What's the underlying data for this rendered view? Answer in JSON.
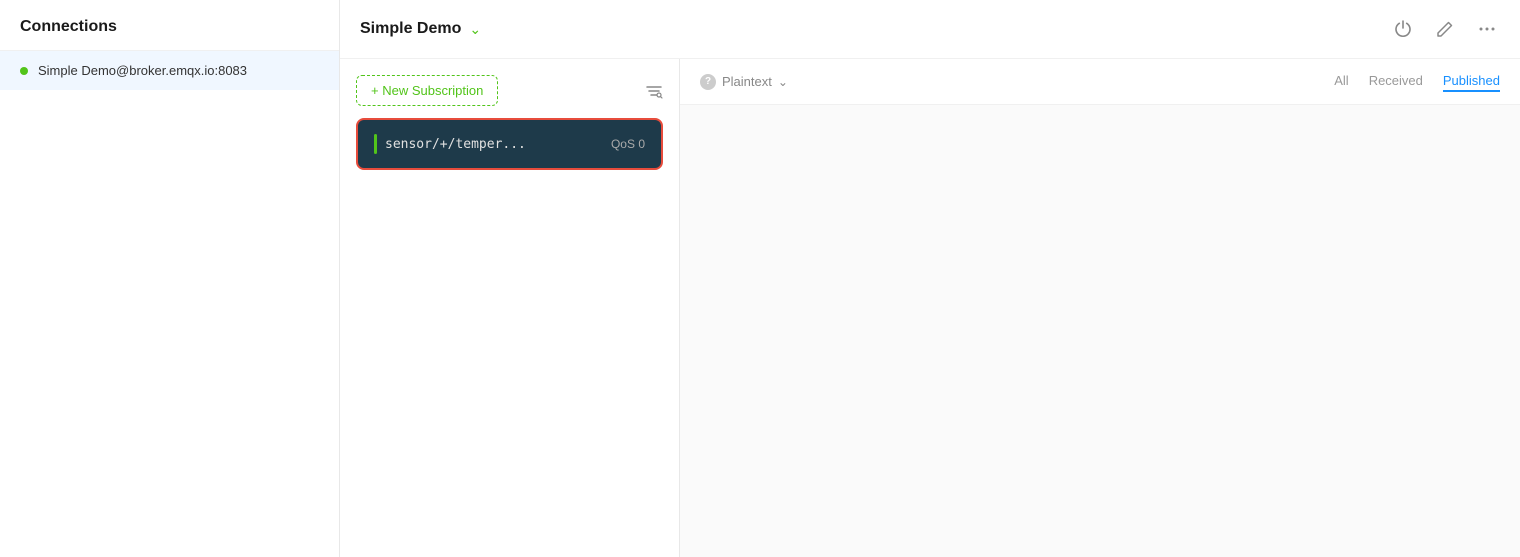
{
  "sidebar": {
    "title": "Connections",
    "items": [
      {
        "id": "simple-demo",
        "label": "Simple Demo@broker.emqx.io:8083",
        "status": "connected",
        "statusColor": "#52c41a"
      }
    ]
  },
  "header": {
    "title": "Simple Demo",
    "chevron": "⌄",
    "icons": {
      "power": "⏻",
      "edit": "✎",
      "more": "⋯"
    }
  },
  "subscriptions": {
    "newButtonLabel": "+ New Subscription",
    "filterIcon": "☰",
    "items": [
      {
        "topic": "sensor/+/temper...",
        "qos": "QoS 0",
        "color": "#52c41a"
      }
    ]
  },
  "messages": {
    "plaintext": {
      "label": "Plaintext",
      "chevron": "⌄"
    },
    "filters": [
      {
        "label": "All",
        "active": false
      },
      {
        "label": "Received",
        "active": false
      },
      {
        "label": "Published",
        "active": true
      }
    ]
  }
}
